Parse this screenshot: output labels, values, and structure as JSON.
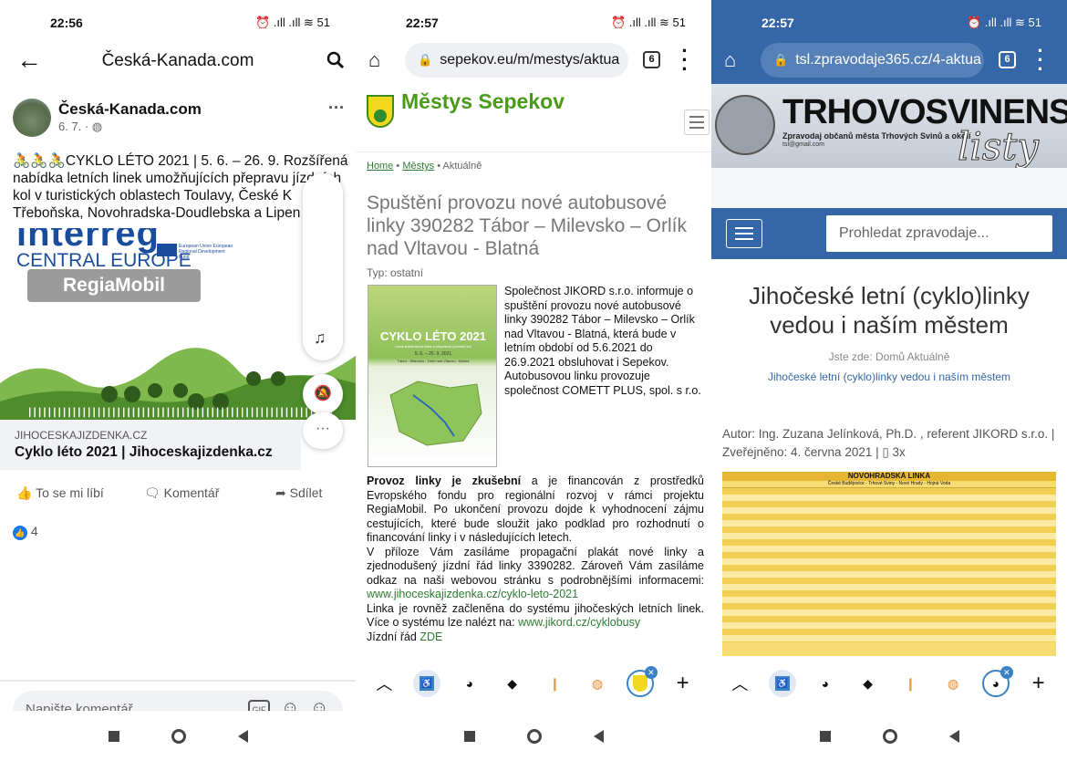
{
  "fb": {
    "time": "22:56",
    "status_icons": "⏰ .ıll .ıll ≋ 51",
    "header_title": "Česká-Kanada.com",
    "page_name": "Česká-Kanada.com",
    "post_date": "6. 7. ·",
    "post_text": "🚴🚴🚴CYKLO LÉTO 2021 | 5. 6. – 26. 9. Rozšířená nabídka letních linek umožňujících přepravu jízdních kol v turistických oblastech Toulavy, České K Třeboňska, Novohradska-Doudlebska a Lipen",
    "banner_interreg": "interreg",
    "banner_ce": "CENTRAL EUROPE",
    "banner_eu": "European Union European Regional Development Fund",
    "banner_regia": "RegiaMobil",
    "link_domain": "JIHOCESKAJIZDENKA.CZ",
    "link_title": "Cyklo léto 2021 | Jihoceskajizdenka.cz",
    "like": "To se mi líbí",
    "comment": "Komentář",
    "share": "Sdílet",
    "reactions": "4",
    "comment_placeholder": "Napište komentář...",
    "gif": "GIF"
  },
  "sepekov": {
    "time": "22:57",
    "status_icons": "⏰ .ıll .ıll ≋ 51",
    "url": "sepekov.eu/m/mestys/aktua",
    "tabs": "6",
    "site_title": "Městys Sepekov",
    "crumb_home": "Home",
    "crumb_sep": " • ",
    "crumb_mestys": "Městys",
    "crumb_current": "Aktuálně",
    "article_title": "Spuštění provozu nové autobusové linky 390282 Tábor – Milevsko – Orlík nad Vltavou - Blatná",
    "type": "Typ: ostatní",
    "poster_title": "CYKLO LÉTO 2021",
    "poster_sub": "nová autobusová linka s přepravou jízdních kol",
    "poster_dates": "5. 6. – 26. 9. 2021",
    "poster_route": "Tábor - Milevsko - Orlík nad Vltavou - Blatná",
    "intro": "Společnost JIKORD s.r.o. informuje o spuštění provozu nové autobusové linky 390282 Tábor – Milevsko – Orlík nad Vltavou - Blatná, která bude v letním období od 5.6.2021 do 26.9.2021 obsluhovat i Sepekov. Autobusovou linku provozuje společnost COMETT PLUS, spol. s r.o.",
    "p1_bold": "Provoz linky je zkušební",
    "p1_rest": " a je financován z prostředků Evropského fondu pro regionální rozvoj v rámci projektu RegiaMobil. Po ukončení provozu dojde k vyhodnocení zájmu cestujících, které bude sloužit jako podklad pro rozhodnutí o financování linky i v následujících letech.",
    "p2": "V příloze Vám zasíláme propagační plakát nové linky a zjednodušený jízdní řád linky 3390282. Zároveň Vám zasíláme odkaz na naši webovou stránku s podrobnějšími informacemi: ",
    "p2_link": "www.jihoceskajizdenka.cz/cyklo-leto-2021",
    "p3": "Linka je rovněž začleněna do systému jihočeských letních linek. Více o systému lze nalézt na: ",
    "p3_link": "www.jikord.cz/cyklobusy",
    "p4": "Jízdní řád ",
    "p4_link": "ZDE"
  },
  "tsl": {
    "time": "22:57",
    "status_icons": "⏰ .ıll .ıll ≋ 51",
    "url": "tsl.zpravodaje365.cz/4-aktua",
    "tabs": "6",
    "masthead": "TRHOVOSVINENSKÉ",
    "masthead_sub": "Zpravodaj občanů města Trhových Svinů a okolí",
    "masthead_email": "tsl@gmail.com",
    "masthead_listy": "listy",
    "search_placeholder": "Prohledat zpravodaje...",
    "article_title": "Jihočeské letní (cyklo)linky vedou i naším městem",
    "crumbs": "Jste zde:  Domů   Aktuálně ",
    "crumb_link": "Jihočeské letní (cyklo)linky vedou i naším městem",
    "author": "Autor: Ing. Zuzana Jelínková, Ph.D. , referent JIKORD s.r.o. | Zveřejněno: 4. června 2021 | ▯ 3x",
    "table_title": "NOVOHRADSKÁ LINKA",
    "table_sub": "České Budějovice - Trhové Sviny - Nové Hrady - Hojná Voda"
  },
  "colors": {
    "fb_blue": "#1877f2",
    "sepekov_green": "#4a9a1a",
    "tsl_blue": "#3466a8",
    "timetable_yellow": "#f2cf52"
  }
}
